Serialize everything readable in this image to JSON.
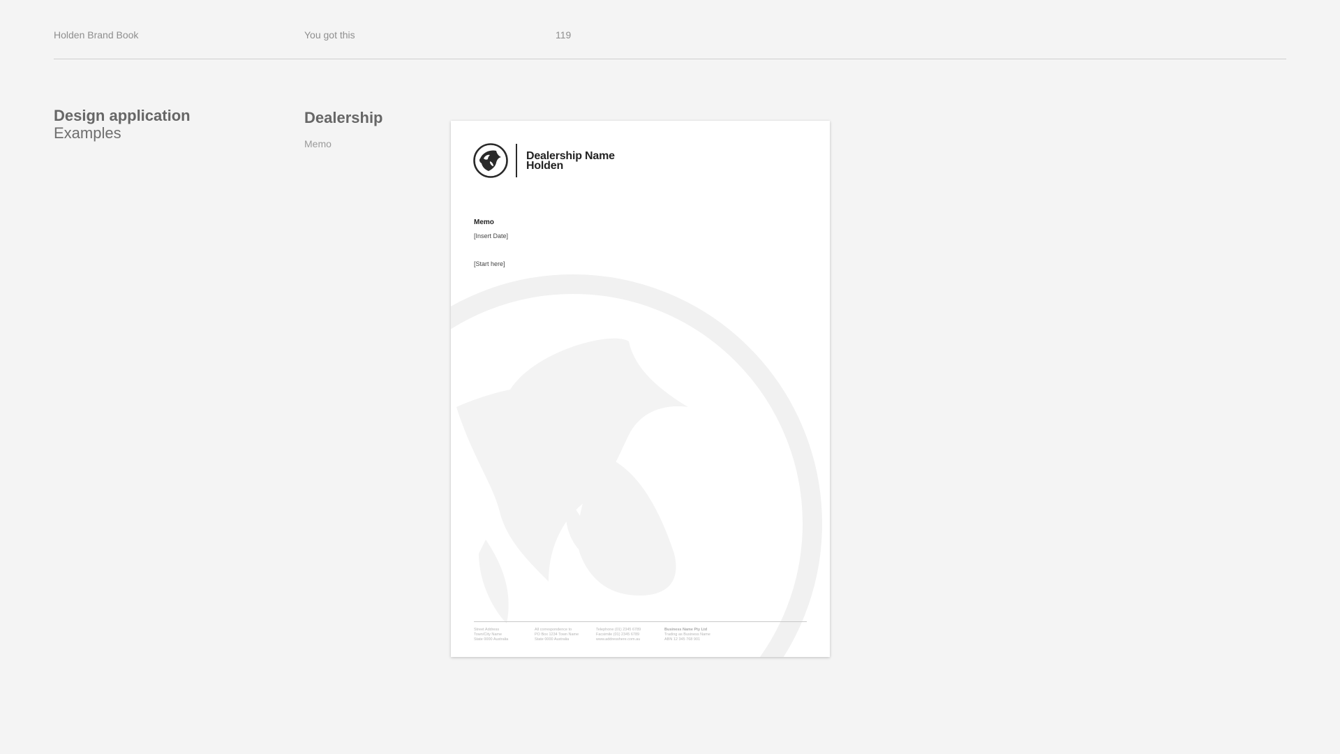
{
  "header": {
    "brand": "Holden Brand Book",
    "tagline": "You got this",
    "page_number": "119"
  },
  "section": {
    "title": "Design application",
    "subtitle": "Examples"
  },
  "category": {
    "title": "Dealership",
    "subtitle": "Memo"
  },
  "memo": {
    "dealer_name": "Dealership Name",
    "dealer_brand": "Holden",
    "heading": "Memo",
    "date_placeholder": "[Insert Date]",
    "start_placeholder": "[Start here]",
    "logo_icon": "holden-lion-icon",
    "watermark_icon": "holden-lion-watermark-icon",
    "footer": {
      "col1": [
        "Street Address",
        "Town/City Name",
        "State 0000 Australia"
      ],
      "col2": [
        "All correspondence to",
        "PO Box 1234 Town Name",
        "State 0000 Australia"
      ],
      "col3": [
        "Telephone (01) 2345 6789",
        "Facsimile (01) 2345 6789",
        "www.addresshere.com.au"
      ],
      "col4": [
        "Business Name Pty Ltd",
        "Trading as Business Name",
        "ABN 12 345 768 901"
      ]
    }
  }
}
